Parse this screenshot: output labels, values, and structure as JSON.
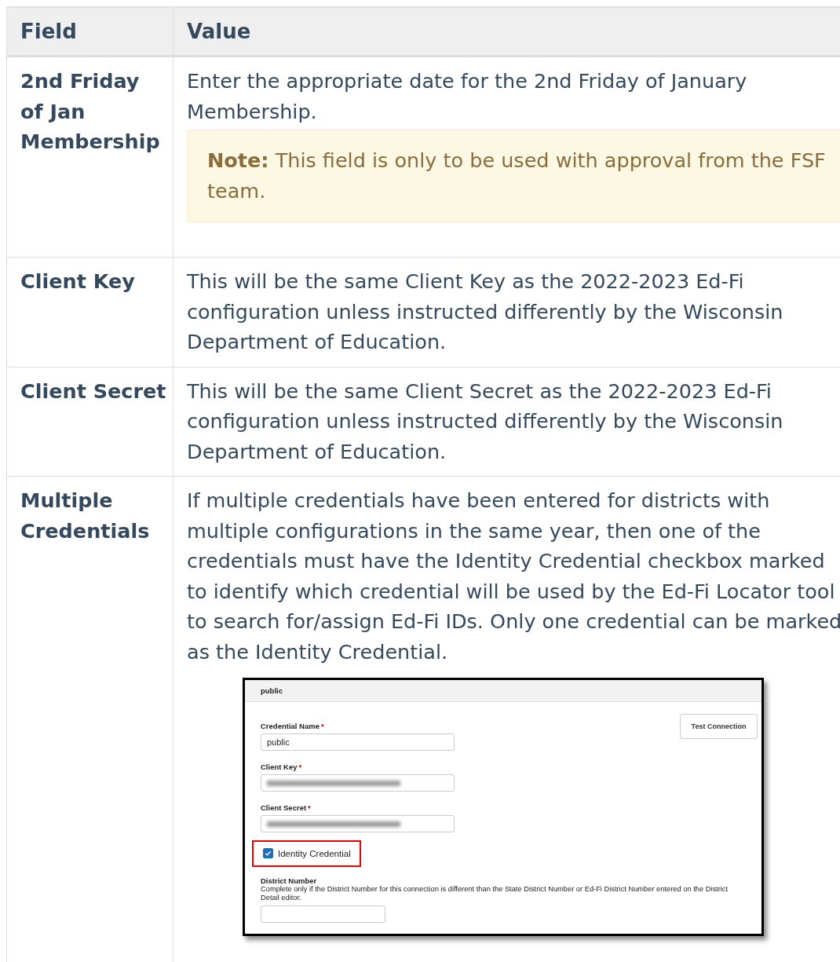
{
  "table": {
    "columns": [
      "Field",
      "Value"
    ],
    "rows": [
      {
        "field": "2nd Friday of Jan Membership",
        "value": "Enter the appropriate date for the 2nd Friday of January Membership.",
        "note": "**Note:** This field is only to be used with approval from the FSF team."
      },
      {
        "field": "Client Key",
        "value": "This will be the same Client Key as the 2022-2023 Ed-Fi configuration unless instructed differently by the Wisconsin Department of Education."
      },
      {
        "field": "Client Secret",
        "value": "This will be the same Client Secret as the 2022-2023 Ed-Fi configuration unless instructed differently by the Wisconsin Department of Education."
      },
      {
        "field": "Multiple Credentials",
        "value": "If multiple credentials have been entered for districts with multiple configurations in the same year, then one of the credentials must have the Identity Credential checkbox marked to identify which credential will be used by the Ed-Fi Locator tool to search for/assign Ed-Fi IDs. Only one credential can be marked as the Identity Credential.",
        "screenshot": {
          "header": "public",
          "button": "Test Connection",
          "fields": [
            {
              "kind": "text",
              "label": "Credential Name",
              "required_mark": "*",
              "value": "public"
            },
            {
              "kind": "blurred",
              "label": "Client Key",
              "required_mark": "*"
            },
            {
              "kind": "blurred",
              "label": "Client Secret",
              "required_mark": "*"
            }
          ],
          "checkbox": {
            "label": "Identity Credential",
            "checked": true,
            "highlighted": true
          },
          "district": {
            "label": "District Number",
            "help": "Complete only if the District Number for this connection is different than the State District Number or Ed-Fi District Number entered on the District Detail editor."
          }
        }
      }
    ]
  }
}
